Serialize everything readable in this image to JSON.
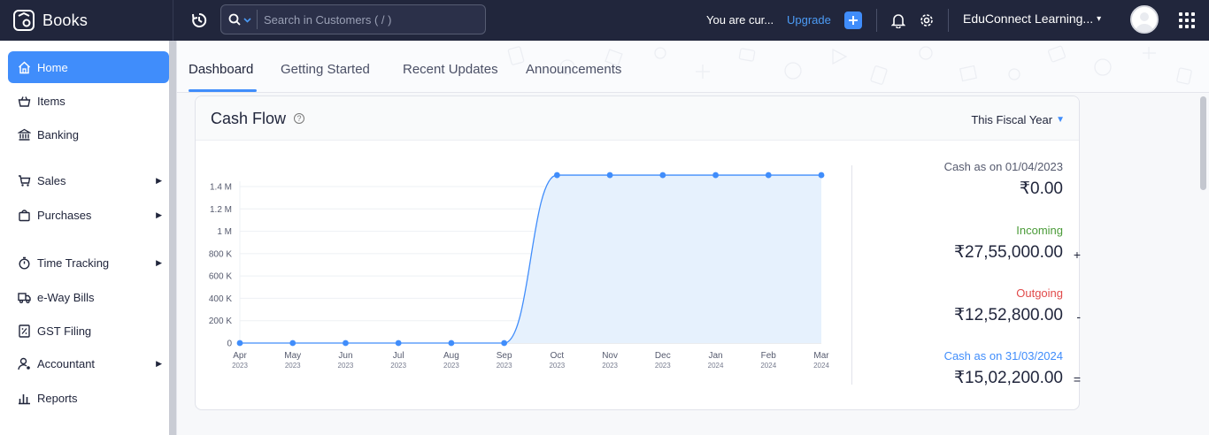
{
  "brand": {
    "name": "Books"
  },
  "topbar": {
    "search_placeholder": "Search in Customers ( / )",
    "trial_text": "You are cur...",
    "upgrade_label": "Upgrade",
    "org_name": "EduConnect Learning..."
  },
  "sidebar": {
    "items": [
      {
        "label": "Home",
        "icon": "home-icon",
        "active": true
      },
      {
        "label": "Items",
        "icon": "basket-icon"
      },
      {
        "label": "Banking",
        "icon": "bank-icon"
      },
      {
        "label": "Sales",
        "icon": "cart-icon",
        "has_submenu": true
      },
      {
        "label": "Purchases",
        "icon": "bag-icon",
        "has_submenu": true
      },
      {
        "label": "Time Tracking",
        "icon": "stopwatch-icon",
        "has_submenu": true
      },
      {
        "label": "e-Way Bills",
        "icon": "truck-icon"
      },
      {
        "label": "GST Filing",
        "icon": "percent-icon"
      },
      {
        "label": "Accountant",
        "icon": "accountant-icon",
        "has_submenu": true
      },
      {
        "label": "Reports",
        "icon": "bar-chart-icon"
      }
    ]
  },
  "tabs": [
    {
      "label": "Dashboard",
      "active": true
    },
    {
      "label": "Getting Started"
    },
    {
      "label": "Recent Updates"
    },
    {
      "label": "Announcements"
    }
  ],
  "cash_flow": {
    "title": "Cash Flow",
    "period": "This Fiscal Year",
    "opening_label": "Cash as on 01/04/2023",
    "opening_value": "₹0.00",
    "incoming_label": "Incoming",
    "incoming_value": "₹27,55,000.00",
    "incoming_op": "+",
    "outgoing_label": "Outgoing",
    "outgoing_value": "₹12,52,800.00",
    "outgoing_op": "-",
    "closing_label": "Cash as on 31/03/2024",
    "closing_value": "₹15,02,200.00",
    "closing_op": "="
  },
  "chart_data": {
    "type": "area",
    "categories": [
      "Apr",
      "May",
      "Jun",
      "Jul",
      "Aug",
      "Sep",
      "Oct",
      "Nov",
      "Dec",
      "Jan",
      "Feb",
      "Mar"
    ],
    "years": [
      "2023",
      "2023",
      "2023",
      "2023",
      "2023",
      "2023",
      "2023",
      "2023",
      "2023",
      "2024",
      "2024",
      "2024"
    ],
    "values": [
      0,
      0,
      0,
      0,
      0,
      0,
      1502200,
      1502200,
      1502200,
      1502200,
      1502200,
      1502200
    ],
    "yticks": [
      "0",
      "200 K",
      "400 K",
      "600 K",
      "800 K",
      "1 M",
      "1.2 M",
      "1.4 M"
    ],
    "ylim": [
      0,
      1400000
    ],
    "colors": {
      "line": "#408dfb",
      "fill": "#e6f1fd"
    }
  }
}
